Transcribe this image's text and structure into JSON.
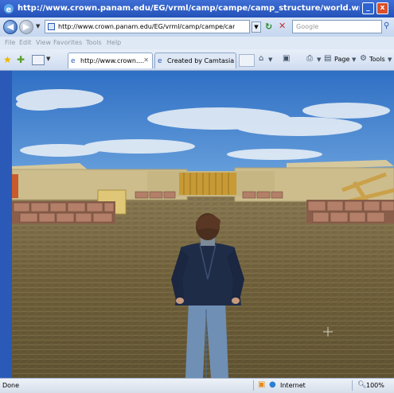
{
  "window": {
    "title": "http://www.crown.panam.edu/EG/vrml/camp/campe/camp_structure/world.wrl - Windows Interne...",
    "min_label": "_",
    "close_label": "x"
  },
  "address_bar": {
    "url": "http://www.crown.panam.edu/EG/vrml/camp/campe/camp_st",
    "search_placeholder": "Google"
  },
  "menu": {
    "items": [
      "File",
      "Edit",
      "View",
      "Favorites",
      "Tools",
      "Help"
    ]
  },
  "tabs": [
    {
      "label": "http://www.crown....",
      "active": true
    },
    {
      "label": "Created by Camtasia St...",
      "active": false
    }
  ],
  "command_bar": {
    "page_label": "Page",
    "tools_label": "Tools"
  },
  "status_bar": {
    "status": "Done",
    "zone": "Internet",
    "zoom": "100%"
  },
  "colors": {
    "title_bar": "#2a59b8",
    "sky": "#3e7ac8",
    "ground": "#7b6a42"
  },
  "scene": {
    "description_icons": [
      "sky",
      "clouds",
      "tent-walls",
      "stone-walls",
      "wooden-gate",
      "avatar",
      "ground"
    ]
  }
}
